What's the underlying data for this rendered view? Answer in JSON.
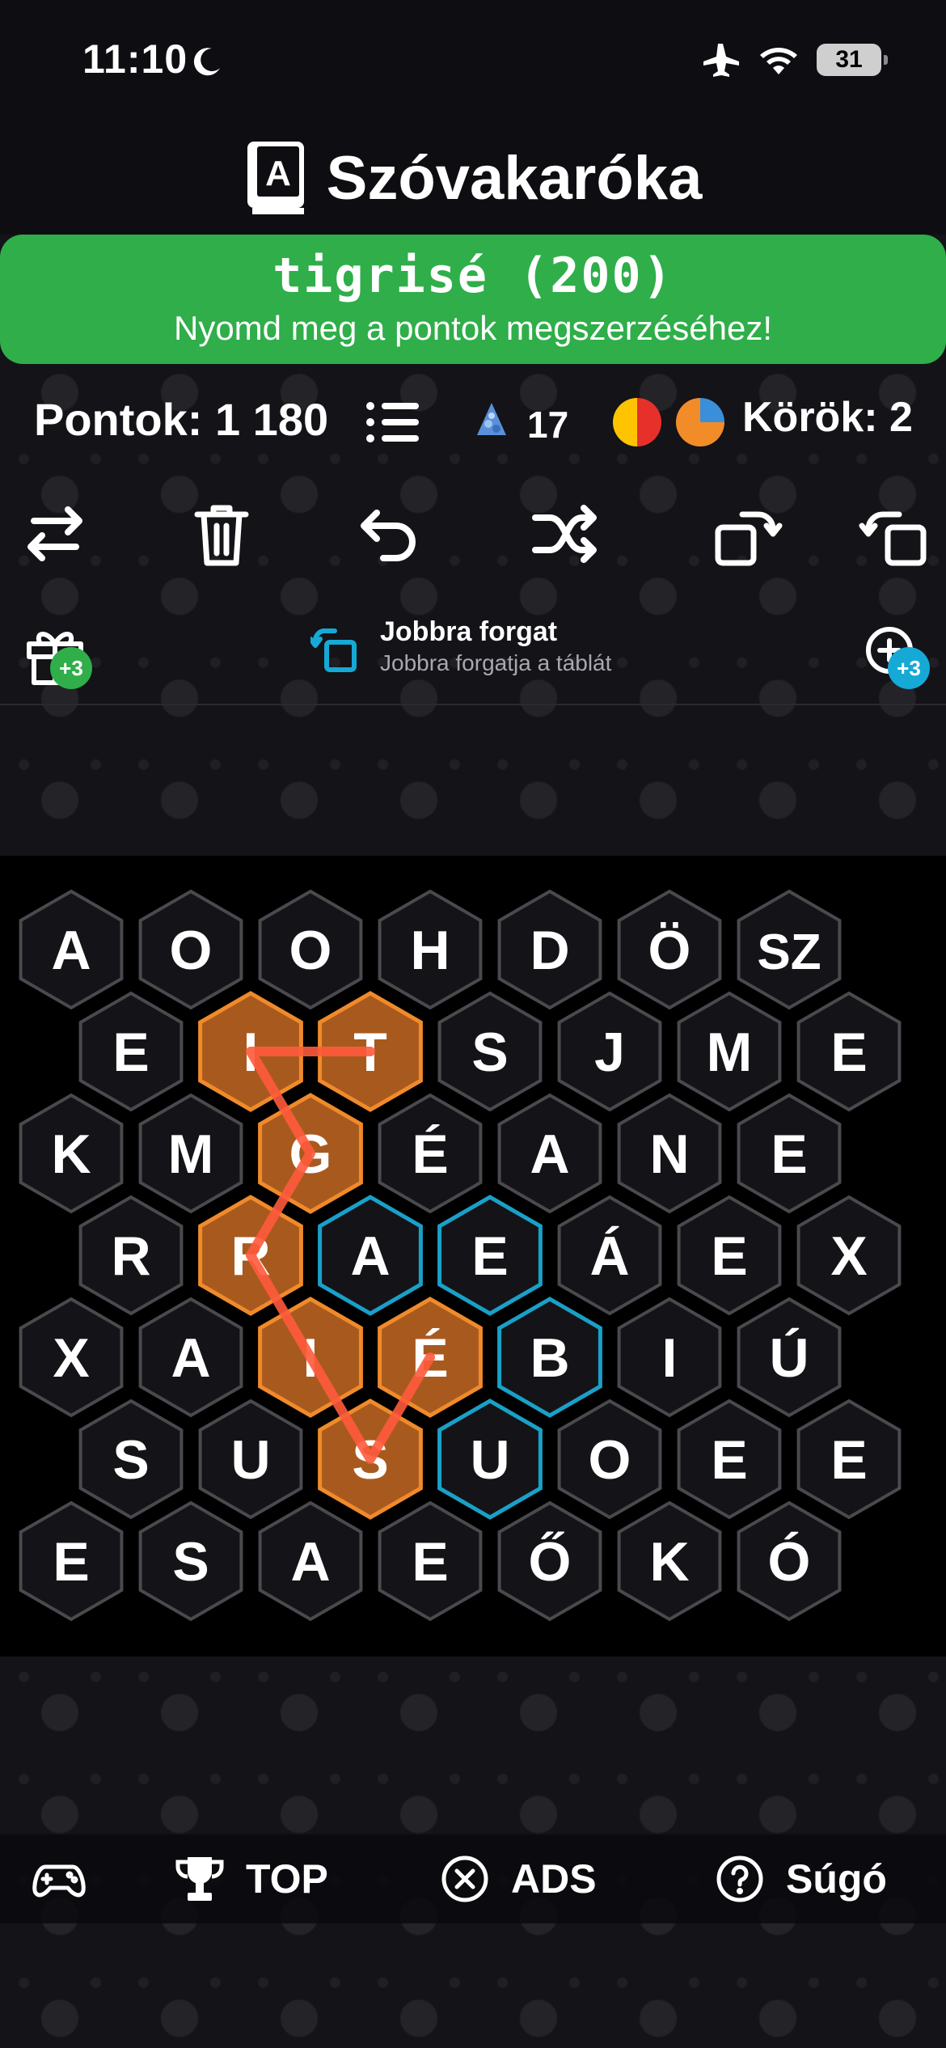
{
  "status_bar": {
    "time": "11:10",
    "battery": "31",
    "icons": [
      "moon-icon",
      "airplane-icon",
      "wifi-icon",
      "battery-icon"
    ]
  },
  "app": {
    "title": "Szóvakaróka",
    "icon": "book-icon"
  },
  "banner": {
    "word": "tigrisé (200)",
    "subtitle": "Nyomd meg a pontok megszerzéséhez!",
    "color": "#2fae4a"
  },
  "stats": {
    "score": "Pontok: 1 180",
    "gems": "17",
    "rounds": "Körök: 2"
  },
  "toolbar": [
    "swap-icon",
    "trash-icon",
    "undo-icon",
    "shuffle-icon",
    "rotate-left-icon",
    "rotate-right-icon"
  ],
  "info": {
    "gift_badge": "+3",
    "hint_title": "Jobbra forgat",
    "hint_desc": "Jobbra forgatja a táblát",
    "zoom_badge": "+3"
  },
  "board": {
    "rows": [
      [
        "A",
        "O",
        "O",
        "H",
        "D",
        "Ö",
        "SZ"
      ],
      [
        "E",
        "I",
        "T",
        "S",
        "J",
        "M",
        "E"
      ],
      [
        "K",
        "M",
        "G",
        "É",
        "A",
        "N",
        "E"
      ],
      [
        "R",
        "R",
        "A",
        "E",
        "Á",
        "E",
        "X"
      ],
      [
        "X",
        "A",
        "I",
        "É",
        "B",
        "I",
        "Ú"
      ],
      [
        "S",
        "U",
        "S",
        "U",
        "O",
        "E",
        "E"
      ],
      [
        "E",
        "S",
        "A",
        "E",
        "Ő",
        "K",
        "Ó"
      ]
    ],
    "selected": [
      [
        1,
        1
      ],
      [
        1,
        2
      ],
      [
        2,
        2
      ],
      [
        3,
        1
      ],
      [
        4,
        2
      ],
      [
        4,
        3
      ],
      [
        5,
        2
      ]
    ],
    "highlighted": [
      [
        3,
        2
      ],
      [
        3,
        3
      ],
      [
        4,
        4
      ],
      [
        5,
        3
      ]
    ],
    "path": [
      [
        1,
        2
      ],
      [
        1,
        1
      ],
      [
        2,
        2
      ],
      [
        3,
        1
      ],
      [
        4,
        2
      ],
      [
        5,
        2
      ],
      [
        4,
        3
      ]
    ],
    "colors": {
      "selected": "#a85a1e",
      "selected_border": "#f08a2a",
      "highlight_border": "#1aa0c8",
      "path": "#ff5a3c",
      "tile": "#141418",
      "tile_border": "#4a4a4e"
    }
  },
  "nav": {
    "top": "TOP",
    "ads": "ADS",
    "help": "Súgó"
  }
}
